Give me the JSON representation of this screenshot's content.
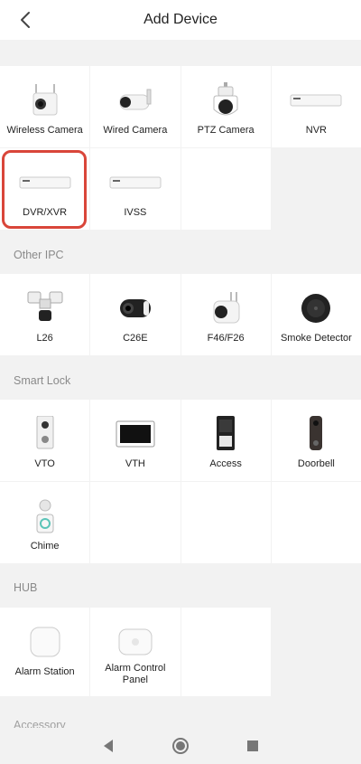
{
  "header": {
    "title": "Add Device"
  },
  "devices": {
    "wireless_camera": "Wireless Camera",
    "wired_camera": "Wired Camera",
    "ptz_camera": "PTZ Camera",
    "nvr": "NVR",
    "dvr_xvr": "DVR/XVR",
    "ivss": "IVSS"
  },
  "sections": {
    "other_ipc": "Other IPC",
    "smart_lock": "Smart Lock",
    "hub": "HUB",
    "accessory": "Accessory"
  },
  "other_ipc": {
    "l26": "L26",
    "c26e": "C26E",
    "f46": "F46/F26",
    "smoke": "Smoke Detector"
  },
  "smart_lock": {
    "vto": "VTO",
    "vth": "VTH",
    "access": "Access",
    "doorbell": "Doorbell",
    "chime": "Chime"
  },
  "hub": {
    "alarm_station": "Alarm Station",
    "alarm_panel": "Alarm Control Panel"
  },
  "colors": {
    "highlight": "#d9463a",
    "background": "#f2f2f2"
  },
  "selected_item": "DVR/XVR"
}
